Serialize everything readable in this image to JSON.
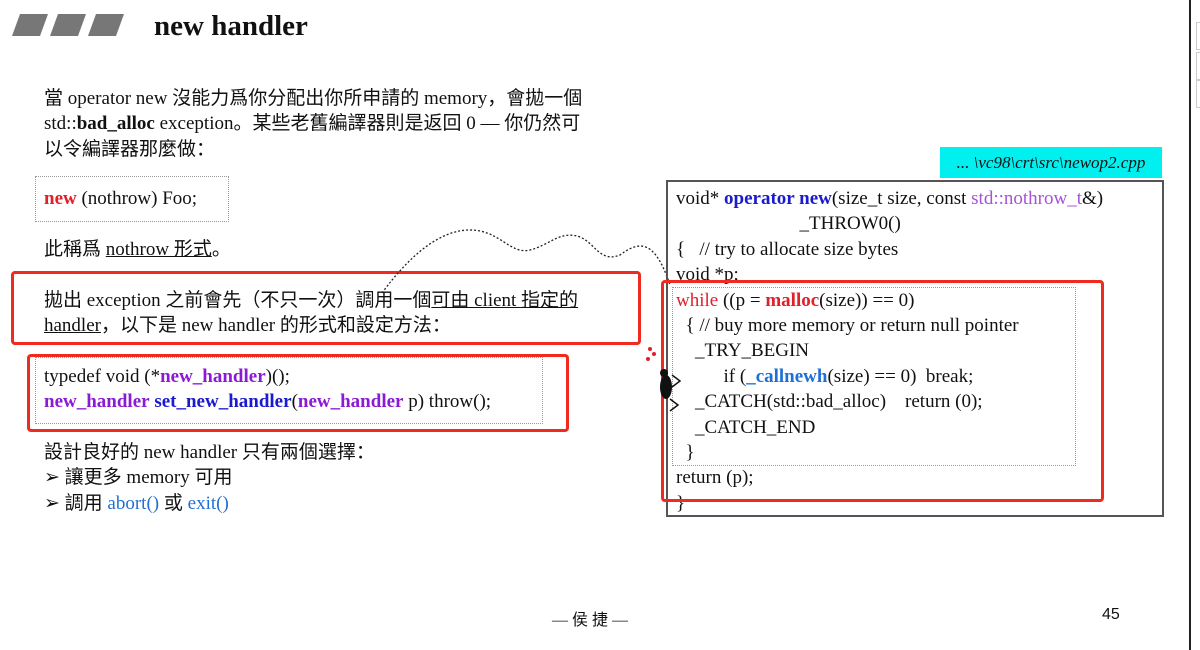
{
  "slide": {
    "title": "new handler",
    "intro": [
      [
        {
          "t": "當 operator new 沒能力爲你分配出你所申請的 memory，會拋一個"
        }
      ],
      [
        {
          "t": "std::"
        },
        {
          "t": "bad_alloc",
          "s": "b"
        },
        {
          "t": " exception。某些老舊編譯器則是返回 0 — 你仍然可"
        }
      ],
      [
        {
          "t": "以令編譯器那麼做："
        }
      ]
    ],
    "nothrow_code": [
      [
        {
          "t": "new",
          "s": "redb"
        },
        {
          "t": " (nothrow) Foo;"
        }
      ]
    ],
    "nothrow_caption": [
      [
        {
          "t": "此稱爲 "
        },
        {
          "t": "nothrow 形式",
          "s": "u"
        },
        {
          "t": "。"
        }
      ]
    ],
    "handler_desc": [
      [
        {
          "t": "拋出 exception 之前會先（不只一次）調用一個"
        },
        {
          "t": "可由 client 指定的",
          "s": "u"
        }
      ],
      [
        {
          "t": "handler",
          "s": "u"
        },
        {
          "t": "，以下是 new handler 的形式和設定方法："
        }
      ]
    ],
    "typedef_code": [
      [
        {
          "t": "typedef void (*"
        },
        {
          "t": "new_handler",
          "s": "purb"
        },
        {
          "t": ")();"
        }
      ],
      [
        {
          "t": "new_handler",
          "s": "purb"
        },
        {
          "t": " "
        },
        {
          "t": "set_new_handler",
          "s": "kwb"
        },
        {
          "t": "("
        },
        {
          "t": "new_handler",
          "s": "purb"
        },
        {
          "t": " p) throw();"
        }
      ]
    ],
    "choices": [
      [
        {
          "t": "設計良好的 new handler 只有兩個選擇："
        }
      ],
      [
        {
          "t": "➢  讓更多 memory 可用"
        }
      ],
      [
        {
          "t": "➢  調用 "
        },
        {
          "t": "abort()",
          "s": "link"
        },
        {
          "t": " 或 "
        },
        {
          "t": "exit()",
          "s": "link"
        }
      ]
    ],
    "source_file": "... \\vc98\\crt\\src\\newop2.cpp",
    "code": [
      [
        {
          "t": "void* "
        },
        {
          "t": "operator new",
          "s": "kw"
        },
        {
          "t": "(size_t size, const "
        },
        {
          "t": "std::nothrow_t",
          "s": "pur"
        },
        {
          "t": "&)"
        }
      ],
      [
        {
          "t": "                          _THROW0()"
        }
      ],
      [
        {
          "t": "{   // try to allocate size bytes"
        }
      ],
      [
        {
          "t": "void *p;"
        }
      ],
      [
        {
          "t": "while",
          "s": "red"
        },
        {
          "t": " ((p = "
        },
        {
          "t": "malloc",
          "s": "redb"
        },
        {
          "t": "(size)) == 0)"
        }
      ],
      [
        {
          "t": "  { // buy more memory or return null pointer"
        }
      ],
      [
        {
          "t": "    _TRY_BEGIN"
        }
      ],
      [
        {
          "t": "          if ("
        },
        {
          "t": "_callnewh",
          "s": "blueb"
        },
        {
          "t": "(size) == 0)  break;"
        }
      ],
      [
        {
          "t": "    _CATCH(std::bad_alloc)    return (0);"
        }
      ],
      [
        {
          "t": "    _CATCH_END"
        }
      ],
      [
        {
          "t": "  }"
        }
      ],
      [
        {
          "t": "return (p);"
        }
      ],
      [
        {
          "t": "}"
        }
      ]
    ],
    "footer": "— 侯 捷 —",
    "page_number": "45"
  },
  "colors": {
    "highlight_box": "#f02a1e",
    "file_label_bg": "#00f0f0",
    "keyword_blue": "#1a1ad0",
    "purple": "#8a1ad6"
  }
}
